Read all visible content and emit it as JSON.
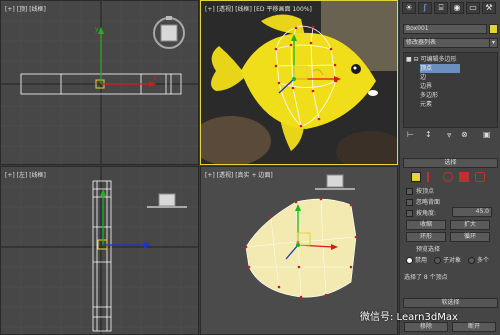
{
  "viewports": {
    "top_left_label": "[+] [顶] [线框]",
    "top_right_label": "[+] [透视] [线框] [ED 平移画面 100%]",
    "bottom_left_label": "[+] [左] [线框]",
    "bottom_right_label": "[+] [透视] [真实 + 边面]"
  },
  "toolbar": {
    "icons": [
      "sun-icon",
      "curve-icon",
      "hierarchy-icon",
      "motion-icon",
      "display-icon",
      "utilities-icon"
    ]
  },
  "object": {
    "name": "Box001",
    "color": "#e6d23a"
  },
  "modifier_list": {
    "label": "修改器列表",
    "arrow": "▾"
  },
  "stack": {
    "items": [
      {
        "label": "可编辑多边形",
        "prefix": "■ ⊟",
        "selected": false
      },
      {
        "label": "顶点",
        "prefix": "",
        "selected": true
      },
      {
        "label": "边",
        "prefix": "",
        "selected": false
      },
      {
        "label": "边界",
        "prefix": "",
        "selected": false
      },
      {
        "label": "多边形",
        "prefix": "",
        "selected": false
      },
      {
        "label": "元素",
        "prefix": "",
        "selected": false
      }
    ],
    "tool_icons": [
      "⊢",
      "↕",
      "⩔",
      "⊗",
      "▣"
    ]
  },
  "selection": {
    "title": "选择",
    "by_vertex": "按顶点",
    "ignore_backfacing": "忽略背面",
    "by_angle": "按角度:",
    "angle_value": "45.0",
    "shrink": "收缩",
    "grow": "扩大",
    "ring": "环形",
    "loop": "循环",
    "preview_title": "预览选择",
    "preview_off": "禁用",
    "preview_subobj": "子对象",
    "preview_multi": "多个",
    "status": "选择了 8 个顶点"
  },
  "soft_selection": {
    "title": "软选择",
    "left_btn": "移除",
    "right_btn": "断开"
  },
  "watermark": "微信号: Learn3dMax",
  "colors": {
    "selection_yellow": "#e6d23a",
    "fish_yellow": "#f0de1a",
    "vertex_red": "#d01818",
    "axis_x": "#d81818",
    "axis_y": "#18b818",
    "axis_z": "#2030d8",
    "viewport_grey": "#474747",
    "panel_grey": "#454545"
  }
}
